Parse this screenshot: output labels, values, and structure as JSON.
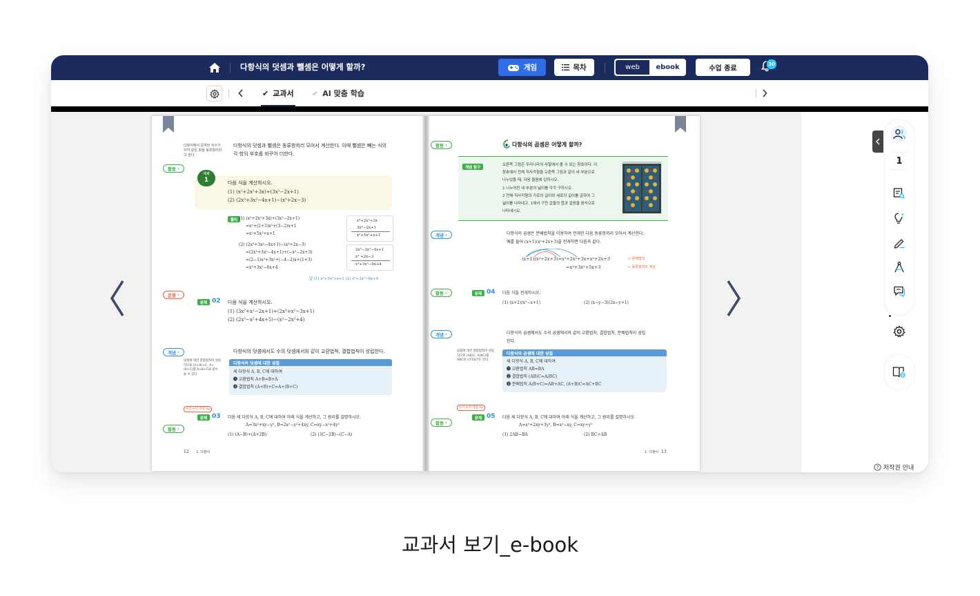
{
  "topbar": {
    "home_icon": "home-icon",
    "lesson_title": "다항식의 덧셈과 뺄셈은 어떻게 할까?",
    "game_label": "게임",
    "toc_label": "목차",
    "view_web": "web",
    "view_ebook": "ebook",
    "end_class_label": "수업 종료",
    "notification_count": "30"
  },
  "tabbar": {
    "tabs": [
      {
        "label": "교과서",
        "active": true
      },
      {
        "label": "AI 맞춤 학습",
        "active": false
      }
    ]
  },
  "left_page": {
    "side_note_1": "다항식에서 문자와 지수가 각각 같은 항을 동류항이라고 한다.",
    "intro_line_1": "다항식의 덧셈과 뺄셈은 동류항끼리 모아서 계산한다. 이때 뺄셈은 빼는 식의",
    "intro_line_2": "각 항의 부호를 바꾸어 더한다.",
    "activity_pill": "활동",
    "example_label": "예제",
    "example_number": "1",
    "example_prompt": "다음 식을 계산하시오.",
    "example_items": [
      "(1) (x²+2x²+3x)+(3x²−2x+1)",
      "(2) (2x³+3x²−4x+1)−(x³+2x−3)"
    ],
    "solution_tag": "풀이",
    "solution_lines": [
      "(1) (x²+2x²+3x)+(3x²−2x+1)",
      "=x²+(2+3)x²+(3−2)x+1",
      "=x²+5x²+x+1",
      "(2) (2x³+3x²−4x+1)−(x³+2x−3)",
      "=(2x³+3x²−4x+1)+(−x³−2x+3)",
      "=(2−1)x³+3x²+(−4−2)x+(1+3)",
      "=x³+3x²−6x+4"
    ],
    "column_calc_1": [
      "x²+2x²+3x",
      "3x²−2x+1",
      "x²+5x²+x+1"
    ],
    "column_calc_2": [
      "2x³−3x²−4x+1",
      "x³     +2x−3",
      "x³+3x²−6x+4"
    ],
    "answer_line": "답  (1) x²+5x²+x+1   (2) x³+3x²−6x+4",
    "problem_pill": "문항",
    "q_tag": "문제",
    "q02_number": "02",
    "q02_prompt": "다음 식을 계산하시오.",
    "q02_items": [
      "(1) (3x²+x²−2x+1)+(2x³+x²−3x+1)",
      "(2) (2x³−x²+4x+5)−(x³−2x²+4)"
    ],
    "concept_pill": "개념",
    "concept_intro": "다항식의 덧셈에서도 수의 덧셈에서와 같이 교환법칙, 결합법칙이 성립한다.",
    "side_note_2": "덧셈에 대한 결합법칙이 성립하므로 (A+B)+C, A+(B+C)를 A+B+C와 같이 쓸 수 있다.",
    "concept_box_title": "다항식의 덧셈에 대한 성질",
    "concept_box_lines": [
      "세 다항식 A, B, C에 대하여",
      "❶ 교환법칙   A+B=B+A",
      "❷ 결합법칙   (A+B)+C=A+(B+C)"
    ],
    "math_up_tag": "수리·논리 역량 Up",
    "q03_number": "03",
    "q03_prompt": "다음 세 다항식 A, B, C에 대하여 아래 식을 계산하고, 그 원리를 설명하시오.",
    "q03_given": "A=3x²+xy−y²,   B=2x²−y²+4xy,   C=xy−x²+4y²",
    "q03_items": [
      "(1) (A−B)+(A+2B)",
      "(2) (3C−2B)−(C−A)"
    ],
    "page_number": "12",
    "footer_label": "1. 다항식"
  },
  "right_page": {
    "activity_pill": "활동",
    "section_title": "다항식의 곱셈은 어떻게 할까?",
    "explore_tag": "개념 탐구",
    "explore_lines": [
      "오른쪽 그림은 우리나라의 사찰에서 볼 수 있는 창호이다. 이",
      "창호에서 전체 직사각형을 오른쪽 그림과 같이 네 부분으로",
      "나누었을 때, 다음 물음에 답하시오.",
      "1  나누어진 네 부분의 넓이를 각각 구하시오.",
      "2  전체 직사각형의 가로의 길이와 세로의 길이를 곱하여 그",
      "   넓이를 나타내고, 1에서 구한 값들의 합과 같음을 음식으로",
      "   나타내시오."
    ],
    "concept_pill": "개념",
    "concept_line_1": "다항식의 곱셈은 분배법칙을 이용하여 전개한 다음 동류항끼리 모아서 계산한다.",
    "concept_line_2": "예를 들어 (x+1)(x²+2x+3)을 전개하면 다음과 같다.",
    "expand_line_1": "(x+1)(x²+2x+3)=x³+2x²+3x+x²+2x+3",
    "expand_line_2": "=x³+3x²+5x+3",
    "expand_note_1": "← 분배법칙",
    "expand_note_2": "← 동류항끼리 계산",
    "q_tag": "문제",
    "q04_number": "04",
    "q04_prompt": "다음 식을 전개하시오.",
    "q04_items": [
      "(1) (x+2)(x²−x+1)",
      "(2) (x−y−3)(2x−y+1)"
    ],
    "concept2_line_1": "다항식의 곱셈에서도 수의 곱셈에서와 같이 교환법칙, 결합법칙, 분배법칙이 성립",
    "concept2_line_2": "한다.",
    "side_note": "곱셈에 대한 결합법칙이 성립하므로 (AB)C, A(BC)를 ABC와 나타내기도 한다.",
    "concept_box_title": "다항식의 곱셈에 대한 성질",
    "concept_box_lines": [
      "세 다항식 A, B, C에 대하여",
      "❶ 교환법칙   AB=BA",
      "❷ 결합법칙   (AB)C=A(BC)",
      "❸ 분배법칙   A(B+C)=AB+AC,   (A+B)C=AC+BC"
    ],
    "math_up_tag": "수리·논리 역량 Up",
    "q05_number": "05",
    "q05_prompt": "다음 세 다항식 A, B, C에 대하여 아래 식을 계산하고, 그 원리를 설명하시오.",
    "q05_given": "A=x²+2xy+3y²,   B=x²−xy,   C=xy+y²",
    "q05_items": [
      "(1) 2AB−BA",
      "(2) BC+AB"
    ],
    "page_number": "13",
    "footer_label": "1. 다항식"
  },
  "side_tools": {
    "user_count": "1",
    "icons": [
      "users-icon",
      "search-document-icon",
      "lightbulb-icon",
      "pen-icon",
      "compass-icon",
      "chat-icon",
      "settings-icon",
      "ebook-icon"
    ]
  },
  "copyright_label": "저작권 안내",
  "caption": "교과서 보기_e-book",
  "colors": {
    "header_navy": "#1c2b5e",
    "accent_blue": "#2f6ce5",
    "activity_green": "#3fae49",
    "concept_blue": "#2d8fd6",
    "problem_red": "#e8603c"
  }
}
